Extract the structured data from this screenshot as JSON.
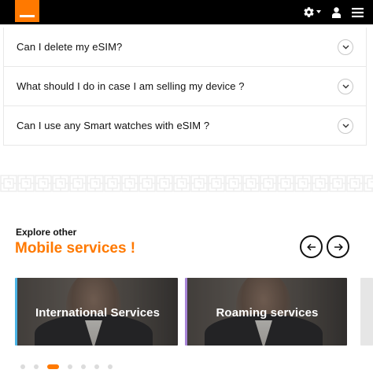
{
  "header": {
    "logo": "orange-logo",
    "icons": [
      "gear-icon",
      "chevron-down-icon",
      "user-icon",
      "menu-icon"
    ]
  },
  "faq": {
    "items": [
      {
        "question": "Can I delete my eSIM?"
      },
      {
        "question": "What should I do in case I am selling my device ?"
      },
      {
        "question": "Can I use any Smart watches with eSIM ?"
      }
    ]
  },
  "explore": {
    "subtitle": "Explore other",
    "title": "Mobile services !",
    "prev_icon": "arrow-left-icon",
    "next_icon": "arrow-right-icon"
  },
  "cards": [
    {
      "label": "International Services",
      "accent": "#4bb4e6"
    },
    {
      "label": "Roaming services",
      "accent": "#a885d8"
    }
  ],
  "pagination": {
    "total": 7,
    "active_index": 2
  },
  "colors": {
    "brand": "#ff7900",
    "header_bg": "#000000"
  }
}
